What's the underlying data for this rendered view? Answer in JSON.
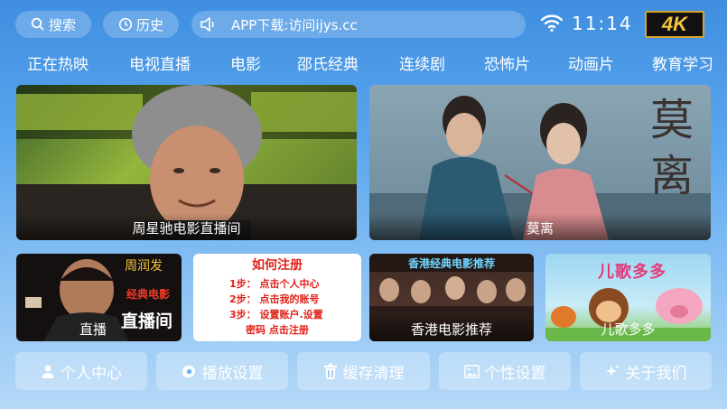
{
  "topbar": {
    "search_label": "搜索",
    "history_label": "历史",
    "notice_text": "APP下载:访问ijys.cc",
    "clock": "11:14",
    "badge": "4K"
  },
  "nav": {
    "items": [
      "正在热映",
      "电视直播",
      "电影",
      "邵氏经典",
      "连续剧",
      "恐怖片",
      "动画片",
      "教育学习"
    ]
  },
  "cards": {
    "big1": {
      "caption": "周星驰电影直播间"
    },
    "big2": {
      "caption": "莫离",
      "poster_title": "莫离"
    },
    "small1": {
      "caption": "直播间",
      "name_tag": "周润发",
      "sub_tag": "经典电影",
      "big_tag": "直播间"
    },
    "small2": {
      "title": "如何注册",
      "steps": [
        "1步：  点击个人中心",
        "2步：  点击我的账号",
        "3步：  设置账户.设置"
      ],
      "last": "密码  点击注册"
    },
    "small3": {
      "caption": "香港电影推荐",
      "banner": "香港经典电影推荐"
    },
    "small4": {
      "caption": "儿歌多多",
      "logo_text": "儿歌多多"
    }
  },
  "bottom": {
    "personal": "个人中心",
    "playback": "播放设置",
    "cache": "缓存清理",
    "custom": "个性设置",
    "about": "关于我们"
  },
  "colors": {
    "badge_gold": "#f3c33a",
    "register_red": "#e0231b"
  }
}
